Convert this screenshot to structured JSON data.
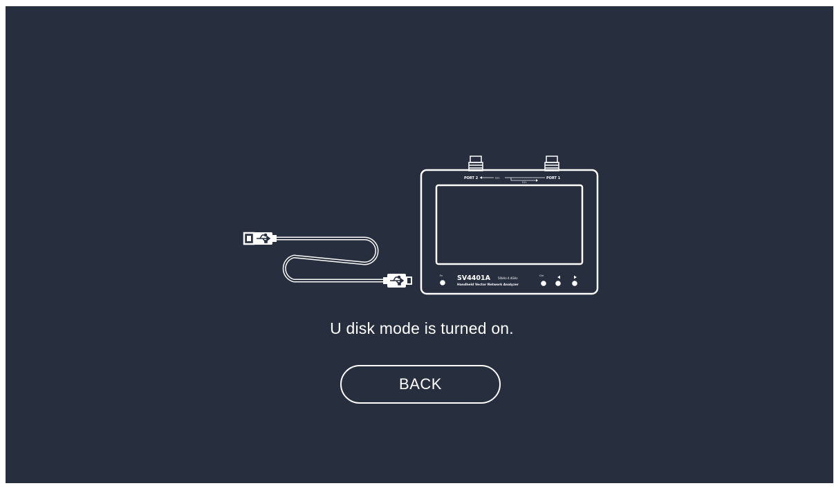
{
  "screen": {
    "background_color": "#272e3e",
    "foreground_color": "#ffffff"
  },
  "device": {
    "model": "SV4401A",
    "frequency_range": "50kHz-4.4GHz",
    "description": "Handheld Vector Network Analyzer",
    "port_left_label": "PORT 2",
    "port_right_label": "PORT 1",
    "s21_label": "S21",
    "s11_label": "S11",
    "fn_label": "Fn",
    "ctrl_label": "Ctrl"
  },
  "icons": {
    "usb_plug": "usb-a-plug-icon",
    "usb_symbol": "usb-trident-icon",
    "device": "vector-network-analyzer-icon"
  },
  "message": {
    "status_text": "U disk mode is turned on."
  },
  "actions": {
    "back_label": "BACK"
  }
}
